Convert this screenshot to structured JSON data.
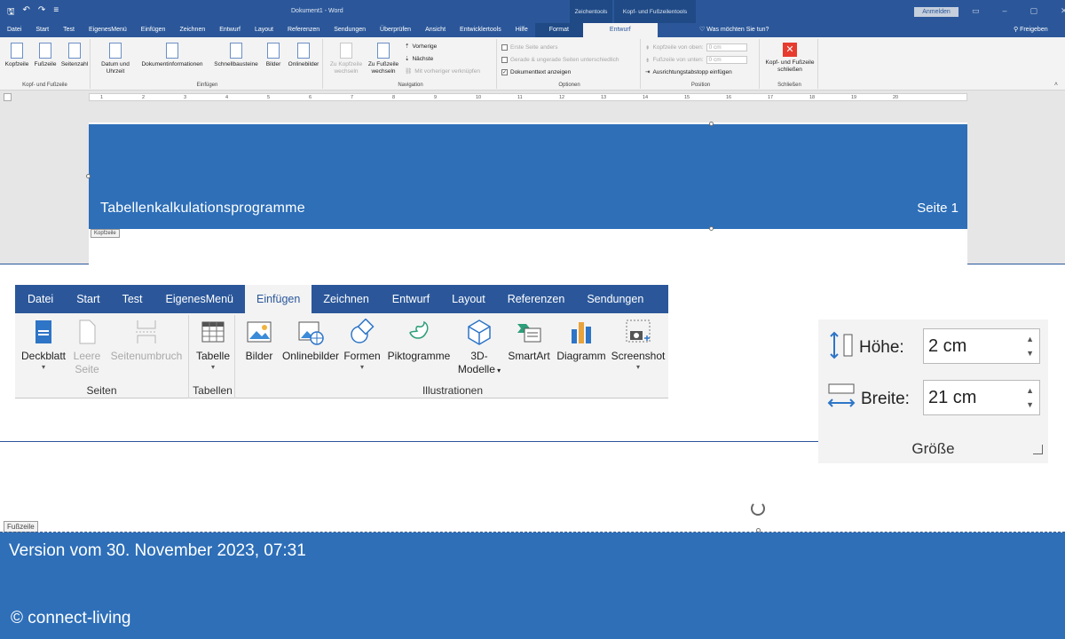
{
  "titlebar": {
    "qat": [
      "🖫",
      "↶",
      "↷",
      "≡"
    ],
    "document_title": "Dokument1 - Word",
    "ctx_zeichentools": "Zeichentools",
    "ctx_kopf": "Kopf- und Fußzeilentools",
    "signin": "Anmelden",
    "winbtns": [
      "▭",
      "–",
      "▢",
      "✕"
    ]
  },
  "tabs_small": [
    "Datei",
    "Start",
    "Test",
    "EigenesMenü",
    "Einfügen",
    "Zeichnen",
    "Entwurf",
    "Layout",
    "Referenzen",
    "Sendungen",
    "Überprüfen",
    "Ansicht",
    "Entwicklertools",
    "Hilfe",
    "Format",
    "Entwurf"
  ],
  "tellme": "Was möchten Sie tun?",
  "share": "Freigeben",
  "ribbon_small": {
    "g1": {
      "label": "Kopf- und Fußzeile",
      "b1": "Kopfzeile",
      "b2": "Fußzeile",
      "b3": "Seitenzahl"
    },
    "g2": {
      "label": "Einfügen",
      "b1": "Datum und Uhrzeit",
      "b2": "Dokumentinformationen",
      "b3": "Schnellbausteine",
      "b4": "Bilder",
      "b5": "Onlinebilder"
    },
    "g3": {
      "label": "Navigation",
      "b1": "Zu Kopfzeile wechseln",
      "b2": "Zu Fußzeile wechseln",
      "l1": "Vorherige",
      "l2": "Nächste",
      "l3": "Mit vorheriger verknüpfen"
    },
    "g4": {
      "label": "Optionen",
      "l1": "Erste Seite anders",
      "l2": "Gerade & ungerade Seiten unterschiedlich",
      "l3": "Dokumenttext anzeigen"
    },
    "g5": {
      "label": "Position",
      "l1": "Kopfzeile von oben:",
      "v1": "0 cm",
      "l2": "Fußzeile von unten:",
      "v2": "0 cm",
      "l3": "Ausrichtungstabstopp einfügen"
    },
    "g6": {
      "label": "Schließen",
      "b1": "Kopf- und Fußzeile schließen"
    }
  },
  "ruler_numbers": [
    "1",
    "2",
    "3",
    "4",
    "5",
    "6",
    "7",
    "8",
    "9",
    "10",
    "11",
    "12",
    "13",
    "14",
    "15",
    "16",
    "17",
    "18",
    "19",
    "20"
  ],
  "header": {
    "title": "Tabellenkalkulationsprogramme",
    "page": "Seite 1",
    "tag": "Kopfzeile"
  },
  "tabs_big": [
    "Datei",
    "Start",
    "Test",
    "EigenesMenü",
    "Einfügen",
    "Zeichnen",
    "Entwurf",
    "Layout",
    "Referenzen",
    "Sendungen"
  ],
  "ribbon_big": {
    "seiten": {
      "label": "Seiten",
      "deckblatt": "Deckblatt",
      "leere_seite": "Leere Seite",
      "seitenumbruch": "Seitenumbruch"
    },
    "tabellen": {
      "label": "Tabellen",
      "tabelle": "Tabelle"
    },
    "illustrationen": {
      "label": "Illustrationen",
      "bilder": "Bilder",
      "onlinebilder": "Onlinebilder",
      "formen": "Formen",
      "piktogramme": "Piktogramme",
      "modelle_1": "3D-",
      "modelle_2": "Modelle",
      "smartart": "SmartArt",
      "diagramm": "Diagramm",
      "screenshot": "Screenshot"
    }
  },
  "size": {
    "hoehe_label": "Höhe:",
    "hoehe_value": "2 cm",
    "breite_label": "Breite:",
    "breite_value": "21 cm",
    "group_label": "Größe"
  },
  "footer": {
    "tag": "Fußzeile",
    "text": "Version vom 30. November 2023, 07:31"
  },
  "copyright": "© connect-living",
  "colors": {
    "word_blue": "#2b579a",
    "band_blue": "#2e6fb8",
    "ribbon_bg": "#f3f3f3"
  }
}
